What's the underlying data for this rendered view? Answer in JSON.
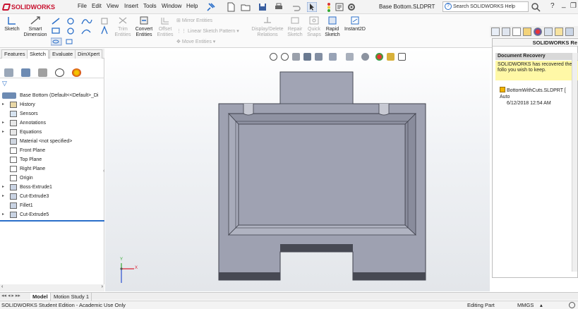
{
  "app": {
    "logo_text": "SOLIDWORKS",
    "document_title": "Base Bottom.SLDPRT"
  },
  "menu": [
    "File",
    "Edit",
    "View",
    "Insert",
    "Tools",
    "Window",
    "Help"
  ],
  "search": {
    "placeholder": "Search SOLIDWORKS Help"
  },
  "window_controls": {
    "help": "?",
    "minimize": "_",
    "restore": "❐",
    "close": "×"
  },
  "command_manager": {
    "sketch": "Sketch",
    "smart_dimension": [
      "Smart",
      "Dimension"
    ],
    "trim_entities": [
      "Trim",
      "Entities"
    ],
    "convert_entities": [
      "Convert",
      "Entities"
    ],
    "offset_entities": [
      "Offset",
      "Entities"
    ],
    "mirror_entities": "Mirror Entities",
    "linear_sketch_pattern": "Linear Sketch Pattern",
    "move_entities": "Move Entities",
    "display_delete_relations": [
      "Display/Delete",
      "Relations"
    ],
    "repair_sketch": [
      "Repair",
      "Sketch"
    ],
    "quick_snaps": [
      "Quick",
      "Snaps"
    ],
    "rapid_sketch": [
      "Rapid",
      "Sketch"
    ],
    "instant2d": "Instant2D"
  },
  "tabs": [
    "Features",
    "Sketch",
    "Evaluate",
    "DimXpert"
  ],
  "active_tab": "Sketch",
  "feature_tree": {
    "root": "Base Bottom  (Default<<Default>_Di",
    "items": [
      {
        "label": "History",
        "expandable": true
      },
      {
        "label": "Sensors",
        "expandable": false
      },
      {
        "label": "Annotations",
        "expandable": true
      },
      {
        "label": "Equations",
        "expandable": true
      },
      {
        "label": "Material <not specified>",
        "expandable": false
      },
      {
        "label": "Front Plane",
        "expandable": false
      },
      {
        "label": "Top Plane",
        "expandable": false
      },
      {
        "label": "Right Plane",
        "expandable": false
      },
      {
        "label": "Origin",
        "expandable": false
      },
      {
        "label": "Boss-Extrude1",
        "expandable": true
      },
      {
        "label": "Cut-Extrude3",
        "expandable": true
      },
      {
        "label": "Fillet1",
        "expandable": false
      },
      {
        "label": "Cut-Extrude5",
        "expandable": true
      }
    ]
  },
  "bottom_tabs": [
    "Model",
    "Motion Study 1"
  ],
  "status": {
    "left": "SOLIDWORKS Student Edition - Academic Use Only",
    "editing": "Editing Part",
    "units": "MMGS"
  },
  "taskpane": {
    "title": "SOLIDWORKS Re",
    "section": "Document Recovery",
    "message": "SOLIDWORKS has recovered the follo you wish to keep.",
    "file_name": "BottomWithCuts.SLDPRT [ Auto",
    "file_date": "6/12/2018 12:54 AM"
  },
  "triad": {
    "x": "X",
    "y": "Y"
  },
  "colors": {
    "part_face": "#9ea1b1",
    "part_edge": "#3d3f4a",
    "part_dark": "#474953",
    "brand_red": "#c8102e"
  }
}
